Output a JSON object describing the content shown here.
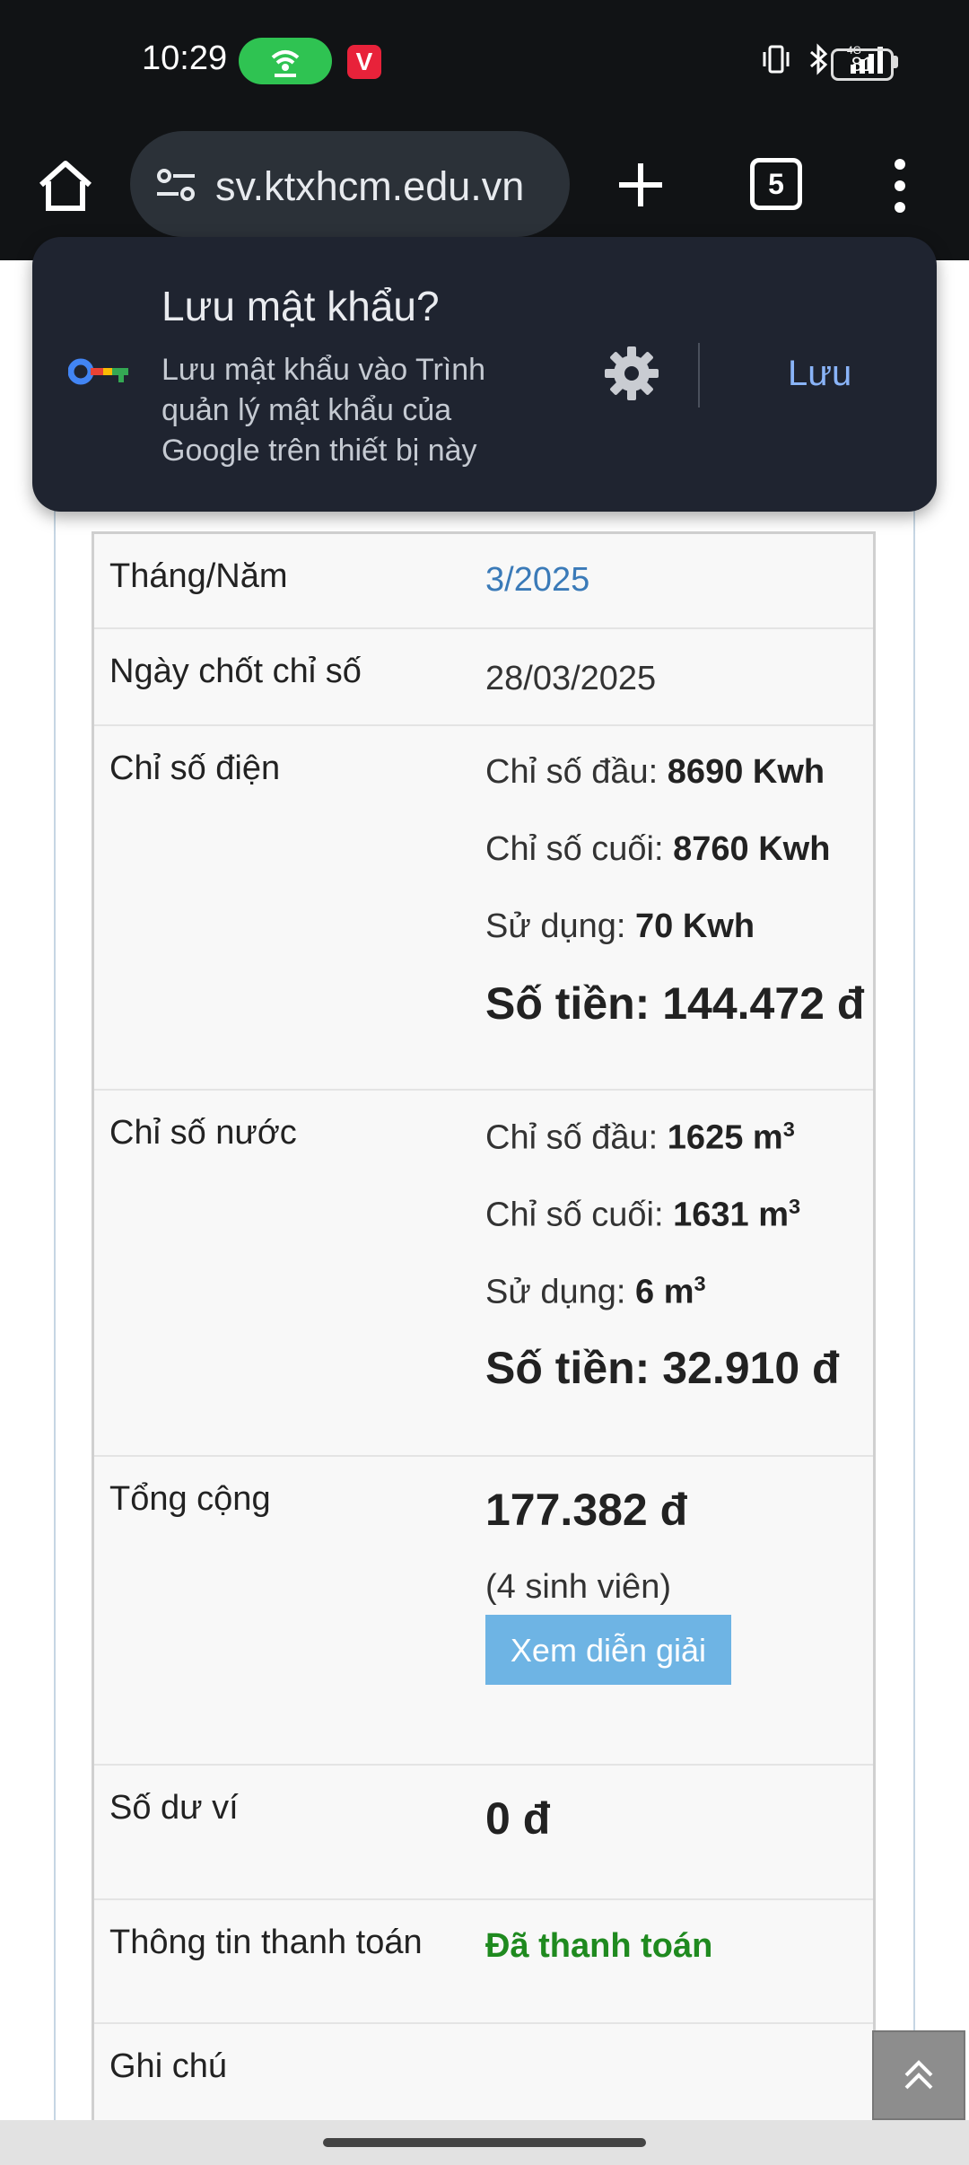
{
  "status": {
    "time": "10:29",
    "battery": "81",
    "network": "4G"
  },
  "browser": {
    "url": "sv.ktxhcm.edu.vn",
    "tab_count": "5"
  },
  "password_prompt": {
    "title": "Lưu mật khẩu?",
    "description": "Lưu mật khẩu vào Trình quản lý mật khẩu của Google trên thiết bị này",
    "save_label": "Lưu"
  },
  "bill": {
    "month_label": "Tháng/Năm",
    "month_value": "3/2025",
    "date_label": "Ngày chốt chỉ số",
    "date_value": "28/03/2025",
    "electric": {
      "label": "Chỉ số điện",
      "start_label": "Chỉ số đầu:",
      "start_value": "8690 Kwh",
      "end_label": "Chỉ số cuối:",
      "end_value": "8760 Kwh",
      "usage_label": "Sử dụng:",
      "usage_value": "70 Kwh",
      "amount": "Số tiền: 144.472 đ"
    },
    "water": {
      "label": "Chỉ số nước",
      "start_label": "Chỉ số đầu:",
      "start_value": "1625 m",
      "end_label": "Chỉ số cuối:",
      "end_value": "1631 m",
      "usage_label": "Sử dụng:",
      "usage_value": "6 m",
      "unit_sup": "3",
      "amount": "Số tiền: 32.910 đ"
    },
    "total": {
      "label": "Tổng cộng",
      "value": "177.382 đ",
      "students": "(4 sinh viên)",
      "explain_button": "Xem diễn giải"
    },
    "wallet": {
      "label": "Số dư ví",
      "value": "0 đ"
    },
    "payment": {
      "label": "Thông tin thanh toán",
      "value": "Đã thanh toán"
    },
    "note": {
      "label": "Ghi chú"
    }
  },
  "colors": {
    "link": "#3a7ab8",
    "paid": "#1f8a1f",
    "button": "#6eb4e4",
    "popup_bg": "#1f2430",
    "accent_save": "#8ab4f8"
  }
}
